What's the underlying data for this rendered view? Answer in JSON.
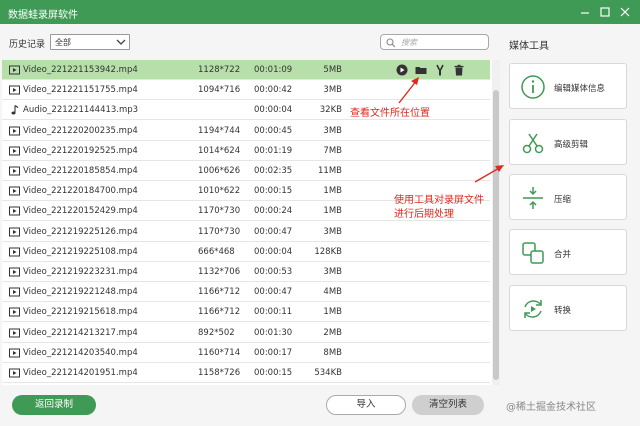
{
  "window": {
    "title": "数据蛙录屏软件"
  },
  "history": {
    "label": "历史记录",
    "filter_value": "全部"
  },
  "search": {
    "placeholder": "搜索"
  },
  "files": [
    {
      "type": "video",
      "name": "Video_221221153942.mp4",
      "resolution": "1128*722",
      "duration": "00:01:09",
      "size": "5MB",
      "selected": true
    },
    {
      "type": "video",
      "name": "Video_221221151755.mp4",
      "resolution": "1094*716",
      "duration": "00:00:42",
      "size": "3MB"
    },
    {
      "type": "audio",
      "name": "Audio_221221144413.mp3",
      "resolution": "",
      "duration": "00:00:04",
      "size": "32KB"
    },
    {
      "type": "video",
      "name": "Video_221220200235.mp4",
      "resolution": "1194*744",
      "duration": "00:00:45",
      "size": "3MB"
    },
    {
      "type": "video",
      "name": "Video_221220192525.mp4",
      "resolution": "1014*624",
      "duration": "00:01:19",
      "size": "7MB"
    },
    {
      "type": "video",
      "name": "Video_221220185854.mp4",
      "resolution": "1006*626",
      "duration": "00:02:35",
      "size": "11MB"
    },
    {
      "type": "video",
      "name": "Video_221220184700.mp4",
      "resolution": "1010*622",
      "duration": "00:00:15",
      "size": "1MB"
    },
    {
      "type": "video",
      "name": "Video_221220152429.mp4",
      "resolution": "1170*730",
      "duration": "00:00:24",
      "size": "1MB"
    },
    {
      "type": "video",
      "name": "Video_221219225126.mp4",
      "resolution": "1170*730",
      "duration": "00:00:47",
      "size": "3MB"
    },
    {
      "type": "video",
      "name": "Video_221219225108.mp4",
      "resolution": "666*468",
      "duration": "00:00:04",
      "size": "128KB"
    },
    {
      "type": "video",
      "name": "Video_221219223231.mp4",
      "resolution": "1132*706",
      "duration": "00:00:53",
      "size": "3MB"
    },
    {
      "type": "video",
      "name": "Video_221219221248.mp4",
      "resolution": "1166*712",
      "duration": "00:00:47",
      "size": "4MB"
    },
    {
      "type": "video",
      "name": "Video_221219215618.mp4",
      "resolution": "1166*712",
      "duration": "00:00:11",
      "size": "1MB"
    },
    {
      "type": "video",
      "name": "Video_221214213217.mp4",
      "resolution": "892*502",
      "duration": "00:01:30",
      "size": "2MB"
    },
    {
      "type": "video",
      "name": "Video_221214203540.mp4",
      "resolution": "1160*714",
      "duration": "00:00:17",
      "size": "8MB"
    },
    {
      "type": "video",
      "name": "Video_221214201951.mp4",
      "resolution": "1158*726",
      "duration": "00:00:15",
      "size": "534KB"
    }
  ],
  "annotations": {
    "open_folder_note": "查看文件所在位置",
    "tools_note_line1": "使用工具对录屏文件",
    "tools_note_line2": "进行后期处理"
  },
  "tools": {
    "title": "媒体工具",
    "items": [
      {
        "label": "编辑媒体信息",
        "icon": "info-icon"
      },
      {
        "label": "高级剪辑",
        "icon": "scissors-icon"
      },
      {
        "label": "压缩",
        "icon": "compress-icon"
      },
      {
        "label": "合并",
        "icon": "merge-icon"
      },
      {
        "label": "转换",
        "icon": "convert-icon"
      }
    ]
  },
  "footer": {
    "back_label": "返回录制",
    "import_label": "导入",
    "clear_label": "清空列表"
  },
  "watermark": "@稀土掘金技术社区",
  "colors": {
    "brand_green": "#3f9a55",
    "selected_row": "#b6dfa9",
    "annotation_red": "#e0281e"
  }
}
